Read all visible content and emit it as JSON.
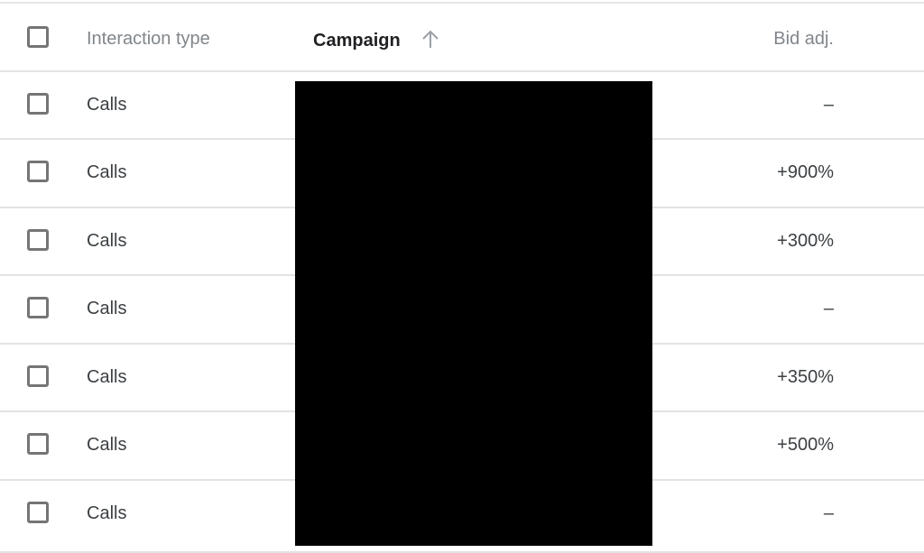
{
  "table": {
    "header": {
      "select_all_checked": false,
      "columns": [
        {
          "key": "interaction_type",
          "label": "Interaction type"
        },
        {
          "key": "campaign",
          "label": "Campaign",
          "sorted": "ascending",
          "sort_icon": "arrow-up-icon"
        },
        {
          "key": "bid_adj",
          "label": "Bid adj."
        }
      ]
    },
    "rows": [
      {
        "checked": false,
        "interaction_type": "Calls",
        "campaign": "",
        "bid_adj": "–"
      },
      {
        "checked": false,
        "interaction_type": "Calls",
        "campaign": "",
        "bid_adj": "+900%"
      },
      {
        "checked": false,
        "interaction_type": "Calls",
        "campaign": "",
        "bid_adj": "+300%"
      },
      {
        "checked": false,
        "interaction_type": "Calls",
        "campaign": "",
        "bid_adj": "–"
      },
      {
        "checked": false,
        "interaction_type": "Calls",
        "campaign": "",
        "bid_adj": "+350%"
      },
      {
        "checked": false,
        "interaction_type": "Calls",
        "campaign": "",
        "bid_adj": "+500%"
      },
      {
        "checked": false,
        "interaction_type": "Calls",
        "campaign": "",
        "bid_adj": "–"
      }
    ],
    "campaign_column_redacted": true
  }
}
